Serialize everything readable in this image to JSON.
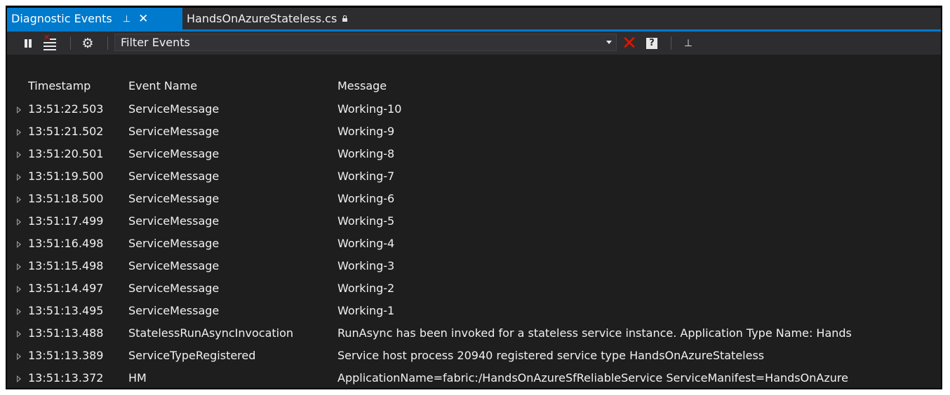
{
  "tabs": {
    "active": {
      "title": "Diagnostic Events",
      "pin_glyph": "⊣",
      "close_glyph": "✕"
    },
    "inactive": {
      "title": "HandsOnAzureStateless.cs"
    }
  },
  "toolbar": {
    "filter_text": "Filter Events",
    "clear_filter_glyph": "✕",
    "help_glyph": "?",
    "pin_glyph": "⊥",
    "gear_glyph": "⚙"
  },
  "grid": {
    "columns": [
      "Timestamp",
      "Event Name",
      "Message"
    ],
    "rows": [
      {
        "timestamp": "13:51:22.503",
        "event": "ServiceMessage",
        "message": "Working-10"
      },
      {
        "timestamp": "13:51:21.502",
        "event": "ServiceMessage",
        "message": "Working-9"
      },
      {
        "timestamp": "13:51:20.501",
        "event": "ServiceMessage",
        "message": "Working-8"
      },
      {
        "timestamp": "13:51:19.500",
        "event": "ServiceMessage",
        "message": "Working-7"
      },
      {
        "timestamp": "13:51:18.500",
        "event": "ServiceMessage",
        "message": "Working-6"
      },
      {
        "timestamp": "13:51:17.499",
        "event": "ServiceMessage",
        "message": "Working-5"
      },
      {
        "timestamp": "13:51:16.498",
        "event": "ServiceMessage",
        "message": "Working-4"
      },
      {
        "timestamp": "13:51:15.498",
        "event": "ServiceMessage",
        "message": "Working-3"
      },
      {
        "timestamp": "13:51:14.497",
        "event": "ServiceMessage",
        "message": "Working-2"
      },
      {
        "timestamp": "13:51:13.495",
        "event": "ServiceMessage",
        "message": "Working-1"
      },
      {
        "timestamp": "13:51:13.488",
        "event": "StatelessRunAsyncInvocation",
        "message": "RunAsync has been invoked for a stateless service instance.  Application Type Name: Hands"
      },
      {
        "timestamp": "13:51:13.389",
        "event": "ServiceTypeRegistered",
        "message": "Service host process 20940 registered service type HandsOnAzureStateless"
      },
      {
        "timestamp": "13:51:13.372",
        "event": "HM",
        "message": "ApplicationName=fabric:/HandsOnAzureSfReliableService ServiceManifest=HandsOnAzure"
      }
    ]
  },
  "colors": {
    "accent": "#007acc",
    "background": "#1e1e1e",
    "toolbar": "#2d2d30",
    "error_red": "#e51400"
  },
  "icons": [
    "pause-icon",
    "clear-log-icon",
    "gear-icon",
    "dropdown-arrow-icon",
    "clear-filter-icon",
    "help-icon",
    "pin-icon",
    "lock-icon",
    "expand-row-icon"
  ]
}
